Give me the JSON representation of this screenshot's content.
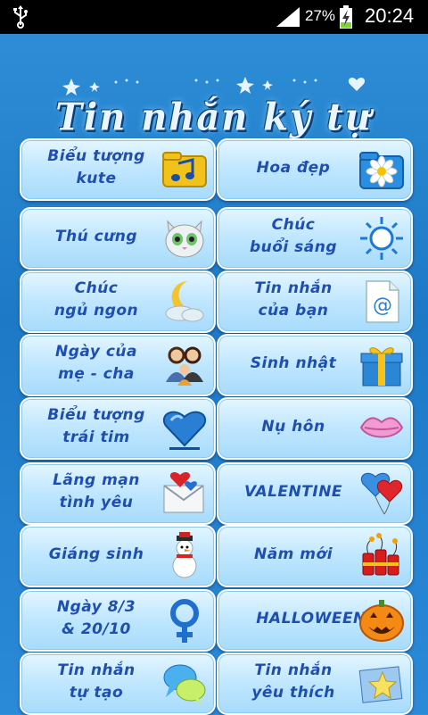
{
  "status_bar": {
    "battery_percent": "27%",
    "time": "20:24"
  },
  "header": {
    "title": "Tin nhắn ký tự"
  },
  "menu": {
    "items": [
      {
        "label": "Biểu tượng\nkute",
        "icon": "music-folder-icon"
      },
      {
        "label": "Hoa đẹp",
        "icon": "flower-folder-icon"
      },
      {
        "label": "Thú cưng",
        "icon": "cat-icon"
      },
      {
        "label": "Chúc\nbuổi sáng",
        "icon": "sun-icon"
      },
      {
        "label": "Chúc\nngủ ngon",
        "icon": "moon-cloud-icon"
      },
      {
        "label": "Tin nhắn\ncủa bạn",
        "icon": "email-at-icon"
      },
      {
        "label": "Ngày của\nmẹ - cha",
        "icon": "family-icon"
      },
      {
        "label": "Sinh nhật",
        "icon": "gift-box-icon"
      },
      {
        "label": "Biểu tượng\ntrái tim",
        "icon": "heart-icon"
      },
      {
        "label": "Nụ hôn",
        "icon": "lips-icon"
      },
      {
        "label": "Lãng mạn\ntình yêu",
        "icon": "love-letter-icon"
      },
      {
        "label": "VALENTINE",
        "icon": "heart-balloons-icon"
      },
      {
        "label": "Giáng sinh",
        "icon": "snowman-icon"
      },
      {
        "label": "Năm mới",
        "icon": "firecracker-icon"
      },
      {
        "label": "Ngày 8/3\n& 20/10",
        "icon": "female-symbol-icon"
      },
      {
        "label": "HALLOWEEN",
        "icon": "pumpkin-icon"
      },
      {
        "label": "Tin nhắn\ntự tạo",
        "icon": "chat-bubbles-icon"
      },
      {
        "label": "Tin nhắn\nyêu thích",
        "icon": "star-note-icon"
      }
    ]
  },
  "colors": {
    "background": "#2383cf",
    "tile": "#bfe6ff",
    "label": "#1e4fb0"
  }
}
